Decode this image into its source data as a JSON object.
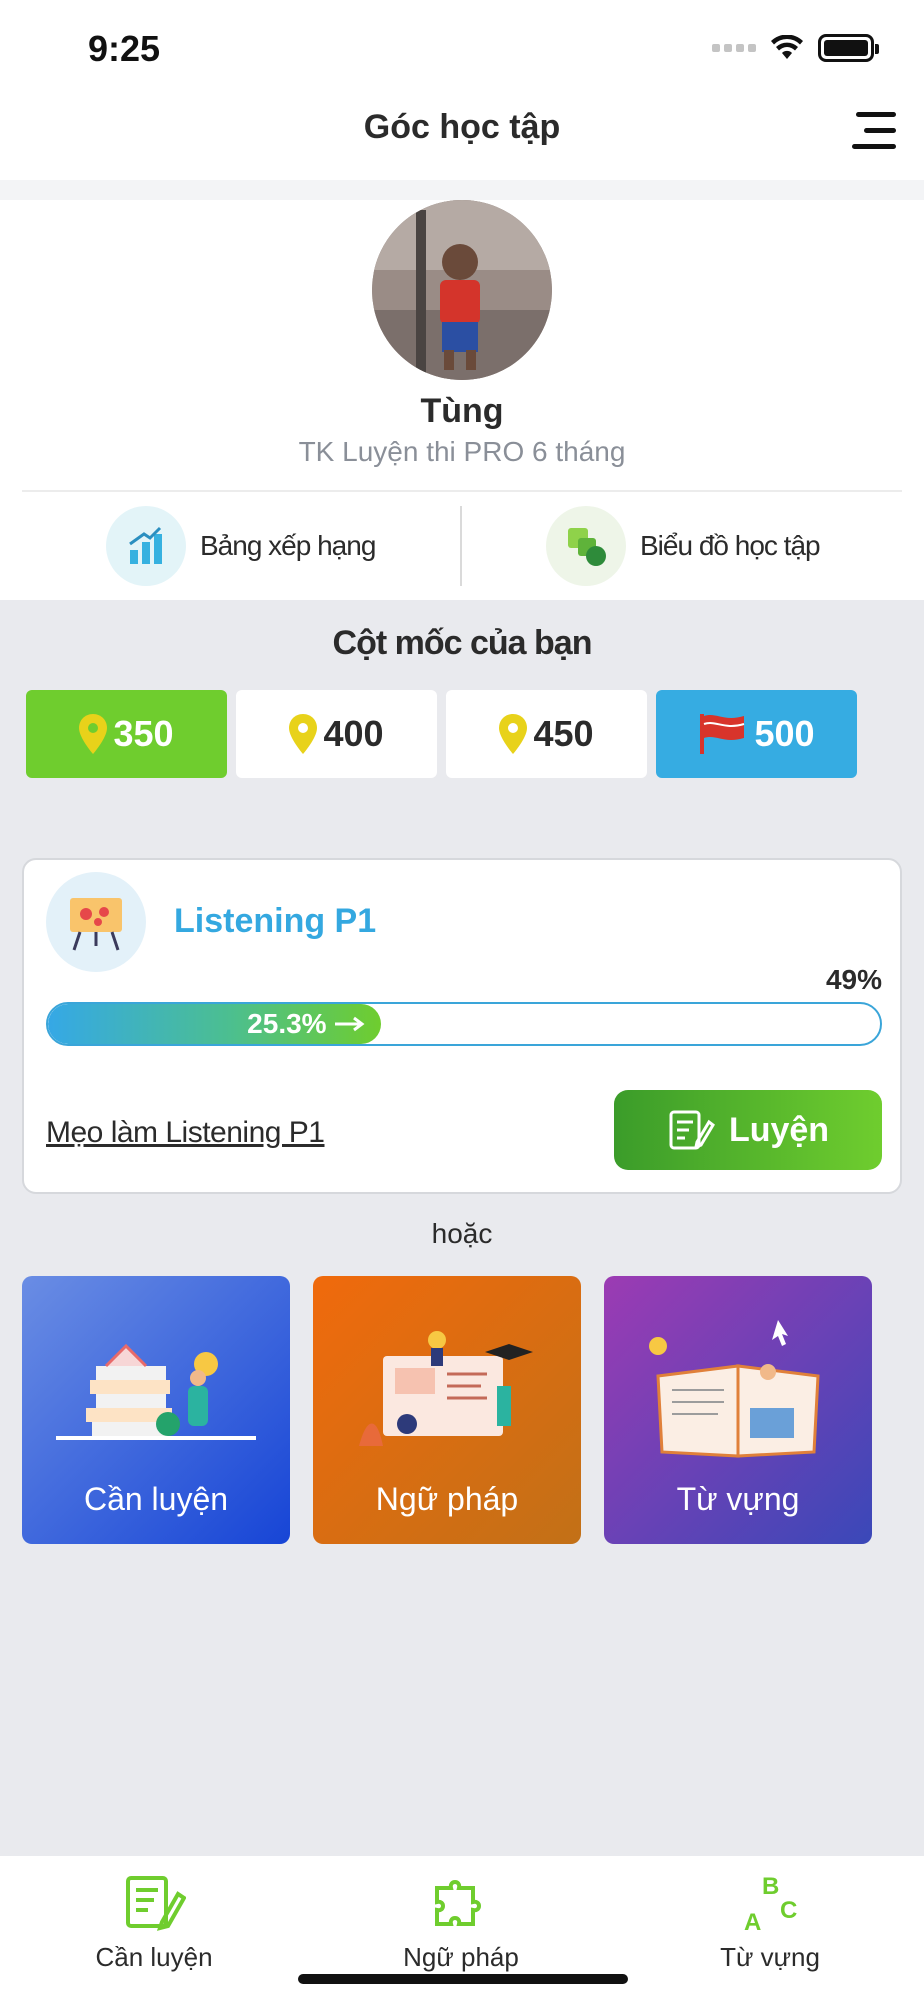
{
  "status_bar": {
    "time": "9:25"
  },
  "header": {
    "title": "Góc học tập"
  },
  "profile": {
    "name": "Tùng",
    "plan": "TK Luyện thi PRO 6 tháng",
    "ranking_label": "Bảng xếp hạng",
    "chart_label": "Biểu đồ học tập"
  },
  "milestones": {
    "title": "Cột mốc của bạn",
    "items": [
      {
        "value": "350",
        "state": "reached",
        "icon": "map-pin-icon"
      },
      {
        "value": "400",
        "state": "pending",
        "icon": "map-pin-icon"
      },
      {
        "value": "450",
        "state": "pending",
        "icon": "map-pin-icon"
      },
      {
        "value": "500",
        "state": "goal",
        "icon": "flag-icon"
      }
    ]
  },
  "practice": {
    "skill": "Listening P1",
    "target_percent": "49%",
    "progress_text": "25.3%",
    "progress_value": 25.3,
    "tips_link": "Mẹo làm Listening P1",
    "practice_button": "Luyện"
  },
  "or_label": "hoặc",
  "tiles": [
    {
      "label": "Cần luyện",
      "color_from": "#6a8de4",
      "color_to": "#1745d6"
    },
    {
      "label": "Ngữ pháp",
      "color_from": "#f06a0c",
      "color_to": "#c27017"
    },
    {
      "label": "Từ vựng",
      "color_from": "#9c3bb3",
      "color_to": "#3a48b8"
    }
  ],
  "bottom_nav": [
    {
      "label": "Cần luyện",
      "icon": "notebook-pen-icon"
    },
    {
      "label": "Ngữ pháp",
      "icon": "puzzle-icon"
    },
    {
      "label": "Từ vựng",
      "icon": "abc-letters-icon"
    }
  ],
  "colors": {
    "accent_green": "#6fcd2e",
    "accent_blue": "#36ace2",
    "pin_yellow": "#e8d21a"
  }
}
